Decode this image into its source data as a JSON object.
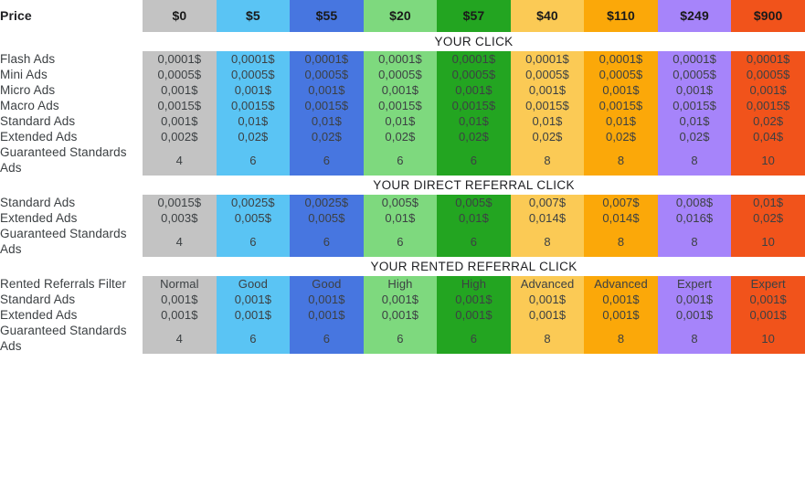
{
  "header": {
    "price_label": "Price",
    "columns": [
      {
        "price": "$0",
        "color": "#c3c3c3"
      },
      {
        "price": "$5",
        "color": "#5ac4f4"
      },
      {
        "price": "$55",
        "color": "#4776e0"
      },
      {
        "price": "$20",
        "color": "#7ed97e"
      },
      {
        "price": "$57",
        "color": "#23a521"
      },
      {
        "price": "$40",
        "color": "#fbca55"
      },
      {
        "price": "$110",
        "color": "#fba809"
      },
      {
        "price": "$249",
        "color": "#a684fa"
      },
      {
        "price": "$900",
        "color": "#f1531b"
      }
    ]
  },
  "sections": [
    {
      "title": "YOUR CLICK",
      "rows": [
        {
          "label": "Flash Ads",
          "values": [
            "0,0001$",
            "0,0001$",
            "0,0001$",
            "0,0001$",
            "0,0001$",
            "0,0001$",
            "0,0001$",
            "0,0001$",
            "0,0001$"
          ]
        },
        {
          "label": "Mini Ads",
          "values": [
            "0,0005$",
            "0,0005$",
            "0,0005$",
            "0,0005$",
            "0,0005$",
            "0,0005$",
            "0,0005$",
            "0,0005$",
            "0,0005$"
          ]
        },
        {
          "label": "Micro Ads",
          "values": [
            "0,001$",
            "0,001$",
            "0,001$",
            "0,001$",
            "0,001$",
            "0,001$",
            "0,001$",
            "0,001$",
            "0,001$"
          ]
        },
        {
          "label": "Macro Ads",
          "values": [
            "0,0015$",
            "0,0015$",
            "0,0015$",
            "0,0015$",
            "0,0015$",
            "0,0015$",
            "0,0015$",
            "0,0015$",
            "0,0015$"
          ]
        },
        {
          "label": "Standard Ads",
          "values": [
            "0,001$",
            "0,01$",
            "0,01$",
            "0,01$",
            "0,01$",
            "0,01$",
            "0,01$",
            "0,01$",
            "0,02$"
          ]
        },
        {
          "label": "Extended Ads",
          "values": [
            "0,002$",
            "0,02$",
            "0,02$",
            "0,02$",
            "0,02$",
            "0,02$",
            "0,02$",
            "0,02$",
            "0,04$"
          ]
        },
        {
          "label": "Guaranteed Standards Ads",
          "values": [
            "4",
            "6",
            "6",
            "6",
            "6",
            "8",
            "8",
            "8",
            "10"
          ]
        }
      ]
    },
    {
      "title": "YOUR DIRECT REFERRAL CLICK",
      "rows": [
        {
          "label": "Standard Ads",
          "values": [
            "0,0015$",
            "0,0025$",
            "0,0025$",
            "0,005$",
            "0,005$",
            "0,007$",
            "0,007$",
            "0,008$",
            "0,01$"
          ]
        },
        {
          "label": "Extended Ads",
          "values": [
            "0,003$",
            "0,005$",
            "0,005$",
            "0,01$",
            "0,01$",
            "0,014$",
            "0,014$",
            "0,016$",
            "0,02$"
          ]
        },
        {
          "label": "Guaranteed Standards Ads",
          "values": [
            "4",
            "6",
            "6",
            "6",
            "6",
            "8",
            "8",
            "8",
            "10"
          ]
        }
      ]
    },
    {
      "title": "YOUR RENTED REFERRAL CLICK",
      "rows": [
        {
          "label": "Rented Referrals Filter",
          "values": [
            "Normal",
            "Good",
            "Good",
            "High",
            "High",
            "Advanced",
            "Advanced",
            "Expert",
            "Expert"
          ]
        },
        {
          "label": "Standard Ads",
          "values": [
            "0,001$",
            "0,001$",
            "0,001$",
            "0,001$",
            "0,001$",
            "0,001$",
            "0,001$",
            "0,001$",
            "0,001$"
          ]
        },
        {
          "label": "Extended Ads",
          "values": [
            "0,001$",
            "0,001$",
            "0,001$",
            "0,001$",
            "0,001$",
            "0,001$",
            "0,001$",
            "0,001$",
            "0,001$"
          ]
        },
        {
          "label": "Guaranteed Standards Ads",
          "values": [
            "4",
            "6",
            "6",
            "6",
            "6",
            "8",
            "8",
            "8",
            "10"
          ]
        }
      ]
    }
  ]
}
